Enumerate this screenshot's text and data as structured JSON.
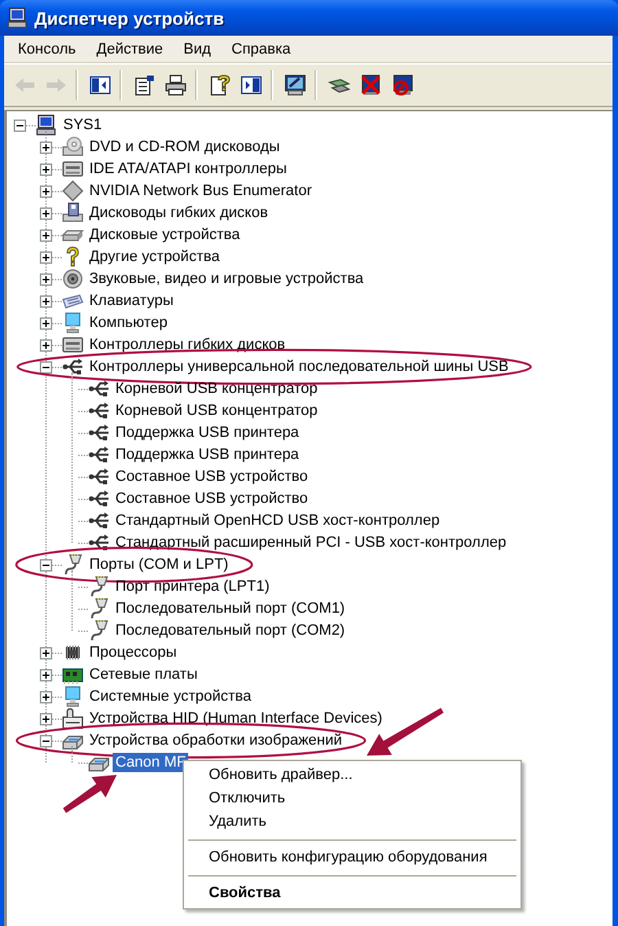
{
  "window": {
    "title": "Диспетчер устройств"
  },
  "menu": [
    "Консоль",
    "Действие",
    "Вид",
    "Справка"
  ],
  "toolbar": [
    {
      "kind": "back",
      "disabled": true
    },
    {
      "kind": "forward",
      "disabled": true
    },
    {
      "kind": "separator"
    },
    {
      "kind": "tree-toggle",
      "disabled": false
    },
    {
      "kind": "separator"
    },
    {
      "kind": "properties",
      "disabled": false
    },
    {
      "kind": "print",
      "disabled": false
    },
    {
      "kind": "separator"
    },
    {
      "kind": "help",
      "disabled": false
    },
    {
      "kind": "pane-toggle",
      "disabled": false
    },
    {
      "kind": "separator"
    },
    {
      "kind": "scan",
      "disabled": false
    },
    {
      "kind": "separator"
    },
    {
      "kind": "update",
      "disabled": false
    },
    {
      "kind": "uninstall",
      "disabled": false
    },
    {
      "kind": "disable",
      "disabled": false
    }
  ],
  "tree": {
    "label": "SYS1",
    "kind": "computer",
    "expanded": true,
    "selected": false,
    "circled": false,
    "pointed": false,
    "children": [
      {
        "label": "DVD и CD-ROM дисководы",
        "kind": "dvd",
        "expanded": false,
        "selected": false,
        "circled": false,
        "pointed": false
      },
      {
        "label": "IDE ATA/ATAPI контроллеры",
        "kind": "controller",
        "expanded": false,
        "selected": false,
        "circled": false,
        "pointed": false
      },
      {
        "label": "NVIDIA Network Bus Enumerator",
        "kind": "diamond",
        "expanded": false,
        "selected": false,
        "circled": false,
        "pointed": false
      },
      {
        "label": "Дисководы гибких дисков",
        "kind": "floppy",
        "expanded": false,
        "selected": false,
        "circled": false,
        "pointed": false
      },
      {
        "label": "Дисковые устройства",
        "kind": "disk",
        "expanded": false,
        "selected": false,
        "circled": false,
        "pointed": false
      },
      {
        "label": "Другие устройства",
        "kind": "unknown",
        "expanded": false,
        "selected": false,
        "circled": false,
        "pointed": false
      },
      {
        "label": "Звуковые, видео и игровые устройства",
        "kind": "sound",
        "expanded": false,
        "selected": false,
        "circled": false,
        "pointed": false
      },
      {
        "label": "Клавиатуры",
        "kind": "keyboard",
        "expanded": false,
        "selected": false,
        "circled": false,
        "pointed": false
      },
      {
        "label": "Компьютер",
        "kind": "monitor",
        "expanded": false,
        "selected": false,
        "circled": false,
        "pointed": false
      },
      {
        "label": "Контроллеры гибких дисков",
        "kind": "controller",
        "expanded": false,
        "selected": false,
        "circled": false,
        "pointed": false
      },
      {
        "label": "Контроллеры универсальной последовательной шины USB",
        "kind": "usb",
        "expanded": true,
        "selected": false,
        "circled": true,
        "pointed": false,
        "children": [
          {
            "label": "Корневой USB концентратор",
            "kind": "usb",
            "selected": false,
            "circled": false,
            "pointed": false
          },
          {
            "label": "Корневой USB концентратор",
            "kind": "usb",
            "selected": false,
            "circled": false,
            "pointed": false
          },
          {
            "label": "Поддержка USB принтера",
            "kind": "usb",
            "selected": false,
            "circled": false,
            "pointed": false
          },
          {
            "label": "Поддержка USB принтера",
            "kind": "usb",
            "selected": false,
            "circled": false,
            "pointed": false
          },
          {
            "label": "Составное USB устройство",
            "kind": "usb",
            "selected": false,
            "circled": false,
            "pointed": false
          },
          {
            "label": "Составное USB устройство",
            "kind": "usb",
            "selected": false,
            "circled": false,
            "pointed": false
          },
          {
            "label": "Стандартный OpenHCD USB хост-контроллер",
            "kind": "usb",
            "selected": false,
            "circled": false,
            "pointed": false
          },
          {
            "label": "Стандартный расширенный PCI - USB хост-контроллер",
            "kind": "usb",
            "selected": false,
            "circled": false,
            "pointed": false
          }
        ]
      },
      {
        "label": "Порты (COM и LPT)",
        "kind": "port",
        "expanded": true,
        "selected": false,
        "circled": true,
        "pointed": false,
        "children": [
          {
            "label": "Порт принтера (LPT1)",
            "kind": "port",
            "selected": false,
            "circled": false,
            "pointed": false
          },
          {
            "label": "Последовательный порт (COM1)",
            "kind": "port",
            "selected": false,
            "circled": false,
            "pointed": false
          },
          {
            "label": "Последовательный порт (COM2)",
            "kind": "port",
            "selected": false,
            "circled": false,
            "pointed": false
          }
        ]
      },
      {
        "label": "Процессоры",
        "kind": "cpu",
        "expanded": false,
        "selected": false,
        "circled": false,
        "pointed": false
      },
      {
        "label": "Сетевые платы",
        "kind": "network",
        "expanded": false,
        "selected": false,
        "circled": false,
        "pointed": false
      },
      {
        "label": "Системные устройства",
        "kind": "monitor",
        "expanded": false,
        "selected": false,
        "circled": false,
        "pointed": false
      },
      {
        "label": "Устройства HID (Human Interface Devices)",
        "kind": "hid",
        "expanded": false,
        "selected": false,
        "circled": false,
        "pointed": false
      },
      {
        "label": "Устройства обработки изображений",
        "kind": "imaging",
        "expanded": true,
        "selected": false,
        "circled": true,
        "pointed": false,
        "children": [
          {
            "label": "Canon MF",
            "kind": "imaging",
            "selected": true,
            "circled": false,
            "pointed": true
          }
        ]
      }
    ]
  },
  "context_menu": [
    {
      "kind": "item",
      "label": "Обновить драйвер...",
      "pointed": true
    },
    {
      "kind": "item",
      "label": "Отключить",
      "pointed": false
    },
    {
      "kind": "item",
      "label": "Удалить",
      "pointed": false
    },
    {
      "kind": "separator"
    },
    {
      "kind": "item",
      "label": "Обновить конфигурацию оборудования",
      "pointed": false
    },
    {
      "kind": "separator"
    },
    {
      "kind": "default",
      "label": "Свойства",
      "pointed": false
    }
  ]
}
